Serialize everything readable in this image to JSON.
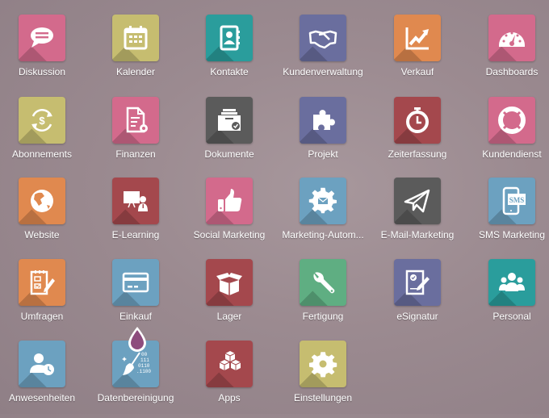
{
  "apps": [
    {
      "label": "Diskussion",
      "icon": "chat-bubble-icon",
      "color": "#d36a8c"
    },
    {
      "label": "Kalender",
      "icon": "calendar-icon",
      "color": "#c6bd70"
    },
    {
      "label": "Kontakte",
      "icon": "address-book-icon",
      "color": "#2a9d9c"
    },
    {
      "label": "Kundenverwaltung",
      "icon": "handshake-icon",
      "color": "#6a6e9e"
    },
    {
      "label": "Verkauf",
      "icon": "line-chart-icon",
      "color": "#e0894f"
    },
    {
      "label": "Dashboards",
      "icon": "speedometer-icon",
      "color": "#d36a8c"
    },
    {
      "label": "Abonnements",
      "icon": "recurring-dollar-icon",
      "color": "#c6bd70"
    },
    {
      "label": "Finanzen",
      "icon": "invoice-gear-icon",
      "color": "#d36a8c"
    },
    {
      "label": "Dokumente",
      "icon": "document-tray-icon",
      "color": "#5b5b5b"
    },
    {
      "label": "Projekt",
      "icon": "puzzle-icon",
      "color": "#6a6e9e"
    },
    {
      "label": "Zeiterfassung",
      "icon": "stopwatch-icon",
      "color": "#a4484d"
    },
    {
      "label": "Kundendienst",
      "icon": "lifebuoy-icon",
      "color": "#d36a8c"
    },
    {
      "label": "Website",
      "icon": "globe-icon",
      "color": "#e0894f"
    },
    {
      "label": "E-Learning",
      "icon": "presentation-teacher-icon",
      "color": "#a4484d"
    },
    {
      "label": "Social Marketing",
      "icon": "thumbs-up-icon",
      "color": "#d36a8c"
    },
    {
      "label": "Marketing-Autom...",
      "icon": "gear-envelope-icon",
      "color": "#6ca1c0"
    },
    {
      "label": "E-Mail-Marketing",
      "icon": "paper-plane-icon",
      "color": "#5b5b5b"
    },
    {
      "label": "SMS Marketing",
      "icon": "sms-phone-icon",
      "color": "#6ca1c0"
    },
    {
      "label": "Umfragen",
      "icon": "checklist-pencil-icon",
      "color": "#e0894f"
    },
    {
      "label": "Einkauf",
      "icon": "credit-card-icon",
      "color": "#6ca1c0"
    },
    {
      "label": "Lager",
      "icon": "open-box-icon",
      "color": "#a4484d"
    },
    {
      "label": "Fertigung",
      "icon": "wrench-icon",
      "color": "#5fae82"
    },
    {
      "label": "eSignatur",
      "icon": "signature-document-icon",
      "color": "#6a6e9e"
    },
    {
      "label": "Personal",
      "icon": "people-group-icon",
      "color": "#2a9d9c"
    },
    {
      "label": "Anwesenheiten",
      "icon": "user-clock-icon",
      "color": "#6ca1c0"
    },
    {
      "label": "Datenbereinigung",
      "icon": "broom-binary-icon",
      "color": "#6ca1c0"
    },
    {
      "label": "Apps",
      "icon": "cubes-icon",
      "color": "#a4484d"
    },
    {
      "label": "Einstellungen",
      "icon": "gear-icon",
      "color": "#c6bd70"
    }
  ],
  "drop_badge_color": "#8d4c7d",
  "binary_text": [
    "00",
    "111",
    "0110",
    ".1100"
  ]
}
